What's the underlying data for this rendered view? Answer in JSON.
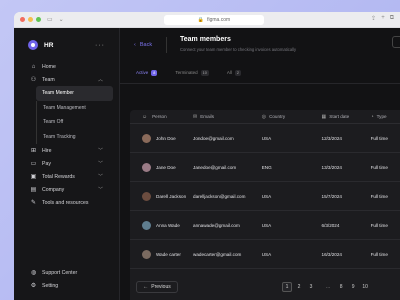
{
  "browser": {
    "url": "figma.com"
  },
  "sidebar": {
    "brand": "HR",
    "items": [
      {
        "label": "Home",
        "icon": "home-icon",
        "chevron": false
      },
      {
        "label": "Team",
        "icon": "team-icon",
        "chevron": true,
        "expanded": true
      }
    ],
    "sub_items": [
      {
        "label": "Team Member",
        "active": true
      },
      {
        "label": "Team Management",
        "active": false
      },
      {
        "label": "Team Off",
        "active": false
      },
      {
        "label": "Team Tracking",
        "active": false
      }
    ],
    "items_after": [
      {
        "label": "Hire",
        "icon": "hire-icon",
        "chevron": true
      },
      {
        "label": "Pay",
        "icon": "pay-icon",
        "chevron": true
      },
      {
        "label": "Total Rewards",
        "icon": "rewards-icon",
        "chevron": true
      },
      {
        "label": "Company",
        "icon": "company-icon",
        "chevron": true
      },
      {
        "label": "Tools and resources",
        "icon": "tools-icon",
        "chevron": false
      }
    ],
    "footer": [
      {
        "label": "Support Center",
        "icon": "support-icon"
      },
      {
        "label": "Setting",
        "icon": "settings-icon"
      }
    ]
  },
  "header": {
    "back_label": "Back",
    "title": "Team members",
    "subtitle": "Connect your team member to checking invoices automatically"
  },
  "tabs": [
    {
      "label": "Active",
      "count": "8",
      "active": true
    },
    {
      "label": "Terminated",
      "count": "10",
      "active": false
    },
    {
      "label": "All",
      "count": "2",
      "active": false
    }
  ],
  "table": {
    "columns": [
      "Person",
      "Emails",
      "Country",
      "Start date",
      "Type"
    ],
    "rows": [
      {
        "name": "John Doe",
        "email": "Jondoe@gmail.com",
        "country": "USA",
        "start": "12/3/2024",
        "type": "Full time",
        "avatar_color": "#8a6a5a"
      },
      {
        "name": "Jane Doe",
        "email": "Janedoe@gmail.com",
        "country": "ENG",
        "start": "13/3/2024",
        "type": "Full time",
        "avatar_color": "#9a7b86"
      },
      {
        "name": "Darell Jackson",
        "email": "darelljackson@gmail.com",
        "country": "USA",
        "start": "15/7/2024",
        "type": "Full time",
        "avatar_color": "#6b4c3f"
      },
      {
        "name": "Anna Wade",
        "email": "annawade@gmail.com",
        "country": "USA",
        "start": "6/3/2024",
        "type": "Full time",
        "avatar_color": "#5f7d8f"
      },
      {
        "name": "Wade carter",
        "email": "wadecarter@gmail.com",
        "country": "USA",
        "start": "16/3/2024",
        "type": "Full time",
        "avatar_color": "#7a6a60"
      }
    ]
  },
  "pagination": {
    "prev_label": "Previous",
    "pages_left": [
      "1",
      "2",
      "3"
    ],
    "ellipsis": "...",
    "pages_right": [
      "8",
      "9",
      "10"
    ],
    "current": "1"
  },
  "colors": {
    "accent": "#6f63e8",
    "bg": "#121214",
    "sidebar": "#161618"
  }
}
